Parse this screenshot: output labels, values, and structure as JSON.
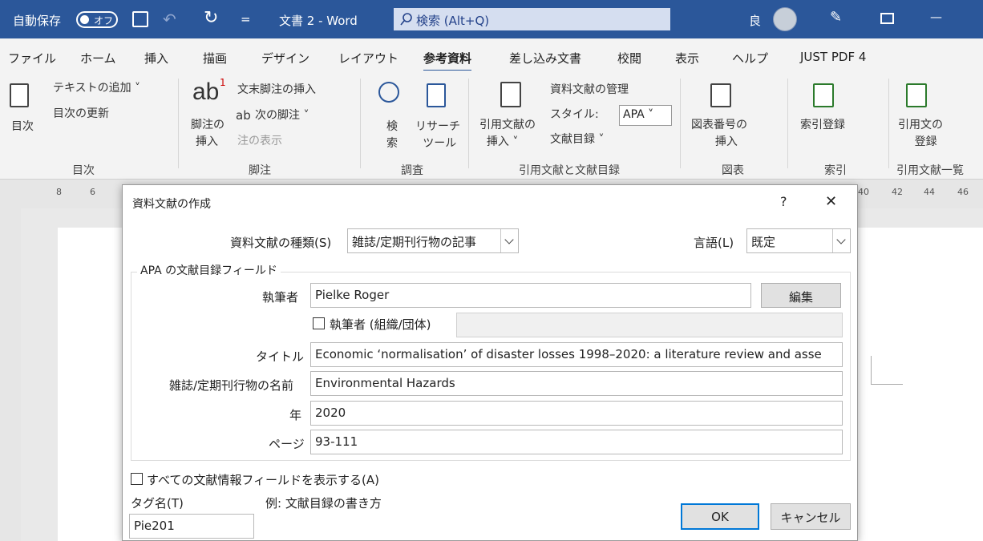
{
  "titlebar": {
    "autosave_label": "自動保存",
    "autosave_toggle": "オフ",
    "doc_title": "文書 2  -  Word",
    "search_placeholder": "検索 (Alt+Q)",
    "user_initial": "良",
    "customize_symbol": "=",
    "minimize_symbol": "—"
  },
  "tabs": [
    "ファイル",
    "ホーム",
    "挿入",
    "描画",
    "デザイン",
    "レイアウト",
    "参考資料",
    "差し込み文書",
    "校閲",
    "表示",
    "ヘルプ",
    "JUST PDF 4"
  ],
  "active_tab": "参考資料",
  "ribbon": {
    "toc_big": "目次",
    "toc_add_text": "テキストの追加 ˅",
    "toc_update": "目次の更新",
    "toc_group": "目次",
    "fn_big1": "脚注の",
    "fn_big2": "挿入",
    "fn_endnote": "文末脚注の挿入",
    "fn_next": "次の脚注 ˅",
    "fn_show": "注の表示",
    "fn_group": "脚注",
    "research_search1": "検",
    "research_search2": "索",
    "research_tool1": "リサーチ",
    "research_tool2": "ツール",
    "research_group": "調査",
    "cite_insert1": "引用文献の",
    "cite_insert2": "挿入 ˅",
    "cite_manage": "資料文献の管理",
    "cite_style_label": "スタイル:",
    "cite_style_value": "APA",
    "cite_biblio": "文献目録 ˅",
    "cite_group": "引用文献と文献目録",
    "caption1": "図表番号の",
    "caption2": "挿入",
    "caption_group": "図表",
    "index_mark": "索引登録",
    "index_group": "索引",
    "toa_mark1": "引用文の",
    "toa_mark2": "登録",
    "toa_group": "引用文献一覧",
    "ab_glyph": "ab",
    "ab_superscript": "1",
    "next_fn_glyph": "ab"
  },
  "ruler": {
    "ticks": [
      "8",
      "6"
    ],
    "right_ticks": [
      "40",
      "42",
      "44",
      "46"
    ]
  },
  "dialog": {
    "title": "資料文献の作成",
    "help": "?",
    "close": "✕",
    "source_type_label": "資料文献の種類(S)",
    "source_type_value": "雑誌/定期刊行物の記事",
    "language_label": "言語(L)",
    "language_value": "既定",
    "group_label": "APA の文献目録フィールド",
    "author_label": "執筆者",
    "author_value": "Pielke Roger",
    "edit_button": "編集",
    "corporate_label": "執筆者 (組織/団体)",
    "corporate_value": "",
    "title_label": "タイトル",
    "title_value": "Economic ‘normalisation’ of disaster losses 1998–2020: a literature review and asse",
    "journal_label": "雑誌/定期刊行物の名前",
    "journal_value": "Environmental Hazards",
    "year_label": "年",
    "year_value": "2020",
    "pages_label": "ページ",
    "pages_value": "93-111",
    "show_all_label": "すべての文献情報フィールドを表示する(A)",
    "tag_label": "タグ名(T)",
    "tag_value": "Pie201",
    "example_label": "例: 文献目録の書き方",
    "ok": "OK",
    "cancel": "キャンセル"
  }
}
